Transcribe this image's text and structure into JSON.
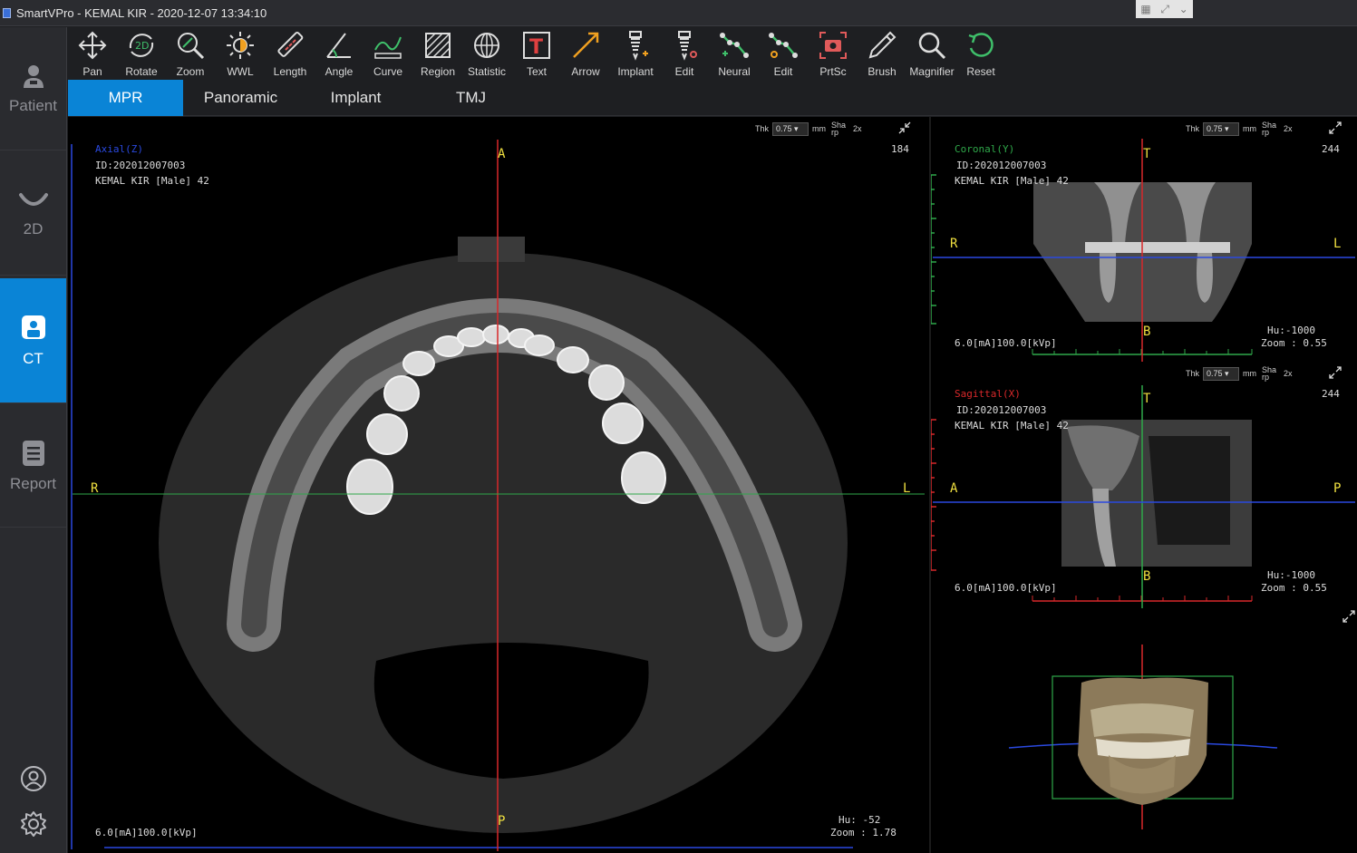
{
  "window": {
    "title": "SmartVPro - KEMAL KIR - 2020-12-07 13:34:10"
  },
  "sidebar": {
    "items": [
      {
        "label": "Patient",
        "icon": "patient-icon",
        "active": false
      },
      {
        "label": "2D",
        "icon": "2d-arch-icon",
        "active": false
      },
      {
        "label": "CT",
        "icon": "ct-scanner-icon",
        "active": true
      },
      {
        "label": "Report",
        "icon": "report-icon",
        "active": false
      }
    ],
    "bottom": [
      {
        "icon": "user-icon"
      },
      {
        "icon": "gear-icon"
      }
    ]
  },
  "toolbar": {
    "tools": [
      {
        "label": "Pan",
        "icon": "pan-icon"
      },
      {
        "label": "Rotate",
        "icon": "rotate-icon"
      },
      {
        "label": "Zoom",
        "icon": "zoom-icon"
      },
      {
        "label": "WWL",
        "icon": "wwl-icon"
      },
      {
        "label": "Length",
        "icon": "length-icon"
      },
      {
        "label": "Angle",
        "icon": "angle-icon"
      },
      {
        "label": "Curve",
        "icon": "curve-icon"
      },
      {
        "label": "Region",
        "icon": "region-icon"
      },
      {
        "label": "Statistic",
        "icon": "statistic-icon"
      },
      {
        "label": "Text",
        "icon": "text-icon"
      },
      {
        "label": "Arrow",
        "icon": "arrow-icon"
      },
      {
        "label": "Implant",
        "icon": "implant-icon"
      },
      {
        "label": "Edit",
        "icon": "edit-implant-icon"
      },
      {
        "label": "Neural",
        "icon": "neural-icon"
      },
      {
        "label": "Edit",
        "icon": "edit-neural-icon"
      },
      {
        "label": "PrtSc",
        "icon": "camera-icon"
      },
      {
        "label": "Brush",
        "icon": "brush-icon"
      },
      {
        "label": "Magnifier",
        "icon": "magnifier-icon"
      },
      {
        "label": "Reset",
        "icon": "reset-icon"
      }
    ],
    "rotate_badge": "2D",
    "text_badge": "T"
  },
  "tabs": [
    {
      "label": "MPR",
      "active": true
    },
    {
      "label": "Panoramic",
      "active": false
    },
    {
      "label": "Implant",
      "active": false
    },
    {
      "label": "TMJ",
      "active": false
    }
  ],
  "colors": {
    "accent": "#0a84d6",
    "axial": "#2a49e0",
    "coronal": "#2fa84a",
    "sagittal": "#d8282a",
    "marker": "#f0e040"
  },
  "axial": {
    "label": "Axial(Z)",
    "id": "ID:202012007003",
    "patient": "KEMAL KIR [Male] 42",
    "slice": "184",
    "thk_label": "Thk",
    "thk_value": "0.75",
    "unit": "mm",
    "sharpen_label": "Sha rp",
    "mag": "2x",
    "hu": "Hu: -52",
    "zoom": "Zoom : 1.78",
    "exposure": "6.0[mA]100.0[kVp]",
    "dir_top": "A",
    "dir_bottom": "P",
    "dir_left": "R",
    "dir_right": "L"
  },
  "coronal": {
    "label": "Coronal(Y)",
    "id": "ID:202012007003",
    "patient": "KEMAL KIR [Male] 42",
    "slice": "244",
    "thk_label": "Thk",
    "thk_value": "0.75",
    "unit": "mm",
    "sharpen_label": "Sha rp",
    "mag": "2x",
    "hu": "Hu:-1000",
    "zoom": "Zoom : 0.55",
    "exposure": "6.0[mA]100.0[kVp]",
    "dir_top": "T",
    "dir_bottom": "B",
    "dir_left": "R",
    "dir_right": "L"
  },
  "sagittal": {
    "label": "Sagittal(X)",
    "id": "ID:202012007003",
    "patient": "KEMAL KIR [Male] 42",
    "slice": "244",
    "thk_label": "Thk",
    "thk_value": "0.75",
    "unit": "mm",
    "sharpen_label": "Sha rp",
    "mag": "2x",
    "hu": "Hu:-1000",
    "zoom": "Zoom : 0.55",
    "exposure": "6.0[mA]100.0[kVp]",
    "dir_top": "T",
    "dir_bottom": "B",
    "dir_left": "A",
    "dir_right": "P"
  }
}
